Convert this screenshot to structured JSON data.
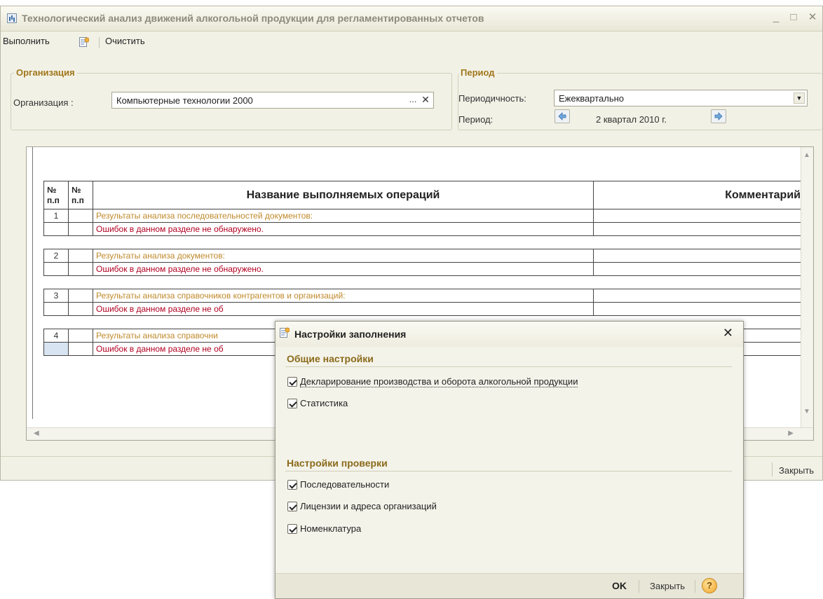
{
  "window": {
    "title": "Технологический анализ движений алкогольной продукции для регламентированных отчетов",
    "minimize": "_",
    "maximize": "□",
    "close": "✕"
  },
  "toolbar": {
    "run_label": "Выполнить",
    "clear_label": "Очистить"
  },
  "organization_group": {
    "title": "Организация",
    "label": "Организация :",
    "value": "Компьютерные технологии 2000",
    "select_btn": "...",
    "clear_btn": "✕"
  },
  "period_group": {
    "title": "Период",
    "periodicity_label": "Периодичность:",
    "periodicity_value": "Ежеквартально",
    "period_label": "Период:",
    "period_value": "2 квартал 2010 г."
  },
  "report": {
    "headers": {
      "num1": "№ п.п",
      "num2": "№ п.п",
      "name": "Название выполняемых операций",
      "comment": "Комментарий"
    },
    "sections": [
      {
        "num": "1",
        "title": "Результаты анализа последовательностей документов:",
        "result": "Ошибок в данном разделе не обнаружено."
      },
      {
        "num": "2",
        "title": "Результаты анализа документов:",
        "result": "Ошибок в данном разделе не обнаружено."
      },
      {
        "num": "3",
        "title": "Результаты анализа справочников контрагентов и организаций:",
        "result": "Ошибок в данном разделе не об"
      },
      {
        "num": "4",
        "title": "Результаты анализа справочни",
        "result": "Ошибок в данном разделе не об"
      }
    ]
  },
  "statusbar": {
    "close_label": "Закрыть"
  },
  "dialog": {
    "title": "Настройки заполнения",
    "close": "✕",
    "general_title": "Общие настройки",
    "general_options": [
      {
        "label": "Декларирование производства и оборота алкогольной продукции",
        "checked": true
      },
      {
        "label": "Статистика",
        "checked": true
      }
    ],
    "check_title": "Настройки проверки",
    "check_options": [
      {
        "label": "Последовательности",
        "checked": true
      },
      {
        "label": "Лицензии и адреса организаций",
        "checked": true
      },
      {
        "label": "Номенклатура",
        "checked": true
      }
    ],
    "ok_label": "OK",
    "close_label": "Закрыть",
    "help_label": "?"
  }
}
